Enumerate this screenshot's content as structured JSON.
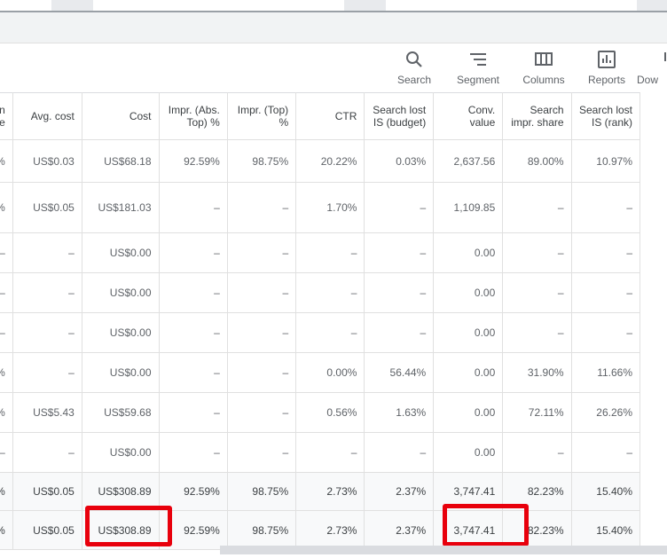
{
  "toolbar": {
    "items": [
      {
        "label": "Search",
        "icon": "search-icon"
      },
      {
        "label": "Segment",
        "icon": "segment-icon"
      },
      {
        "label": "Columns",
        "icon": "columns-icon"
      },
      {
        "label": "Reports",
        "icon": "reports-icon"
      },
      {
        "label": "Dow",
        "icon": "download-icon"
      }
    ]
  },
  "table": {
    "headers": [
      "n\ne",
      "Avg. cost",
      "Cost",
      "Impr. (Abs. Top) %",
      "Impr. (Top) %",
      "CTR",
      "Search lost IS (budget)",
      "Conv. value",
      "Search impr. share",
      "Search lost IS (rank)"
    ],
    "rows": [
      [
        "%",
        "US$0.03",
        "US$68.18",
        "92.59%",
        "98.75%",
        "20.22%",
        "0.03%",
        "2,637.56",
        "89.00%",
        "10.97%"
      ],
      [
        "%",
        "US$0.05",
        "US$181.03",
        "–",
        "–",
        "1.70%",
        "–",
        "1,109.85",
        "–",
        "–"
      ],
      [
        "–",
        "–",
        "US$0.00",
        "–",
        "–",
        "–",
        "–",
        "0.00",
        "–",
        "–"
      ],
      [
        "–",
        "–",
        "US$0.00",
        "–",
        "–",
        "–",
        "–",
        "0.00",
        "–",
        "–"
      ],
      [
        "–",
        "–",
        "US$0.00",
        "–",
        "–",
        "–",
        "–",
        "0.00",
        "–",
        "–"
      ],
      [
        "%",
        "–",
        "US$0.00",
        "–",
        "–",
        "0.00%",
        "56.44%",
        "0.00",
        "31.90%",
        "11.66%"
      ],
      [
        "%",
        "US$5.43",
        "US$59.68",
        "–",
        "–",
        "0.56%",
        "1.63%",
        "0.00",
        "72.11%",
        "26.26%"
      ],
      [
        "–",
        "–",
        "US$0.00",
        "–",
        "–",
        "–",
        "–",
        "0.00",
        "–",
        "–"
      ]
    ],
    "totals": [
      [
        "%",
        "US$0.05",
        "US$308.89",
        "92.59%",
        "98.75%",
        "2.73%",
        "2.37%",
        "3,747.41",
        "82.23%",
        "15.40%"
      ],
      [
        "%",
        "US$0.05",
        "US$308.89",
        "92.59%",
        "98.75%",
        "2.73%",
        "2.37%",
        "3,747.41",
        "82.23%",
        "15.40%"
      ]
    ]
  },
  "colors": {
    "highlight": "#e8000c"
  }
}
